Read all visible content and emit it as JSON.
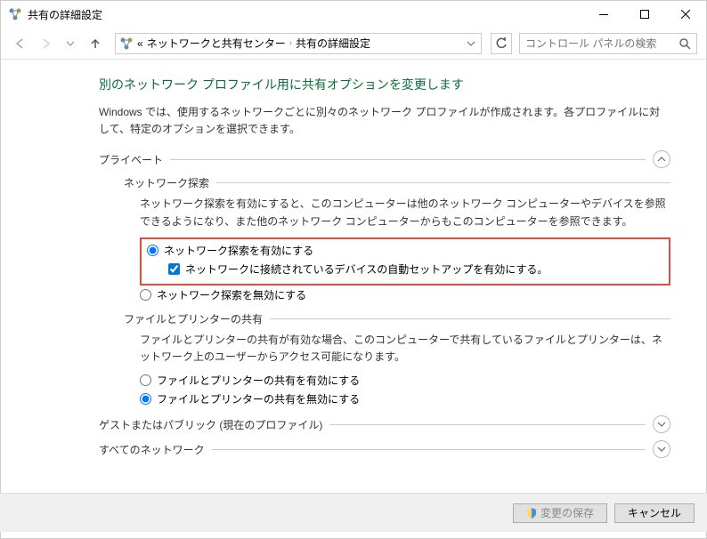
{
  "window": {
    "title": "共有の詳細設定",
    "minimize": "−",
    "maximize": "☐",
    "close": "✕"
  },
  "nav": {
    "breadcrumb_prefix": "«",
    "breadcrumb_item1": "ネットワークと共有センター",
    "breadcrumb_sep": "›",
    "breadcrumb_item2": "共有の詳細設定",
    "search_placeholder": "コントロール パネルの検索"
  },
  "page": {
    "title": "別のネットワーク プロファイル用に共有オプションを変更します",
    "desc": "Windows では、使用するネットワークごとに別々のネットワーク プロファイルが作成されます。各プロファイルに対して、特定のオプションを選択できます。"
  },
  "sections": {
    "private": {
      "label": "プライベート",
      "network_discovery": {
        "label": "ネットワーク探索",
        "desc": "ネットワーク探索を有効にすると、このコンピューターは他のネットワーク コンピューターやデバイスを参照できるようになり、また他のネットワーク コンピューターからもこのコンピューターを参照できます。",
        "radio_enable": "ネットワーク探索を有効にする",
        "checkbox_auto": "ネットワークに接続されているデバイスの自動セットアップを有効にする。",
        "radio_disable": "ネットワーク探索を無効にする"
      },
      "file_printer": {
        "label": "ファイルとプリンターの共有",
        "desc": "ファイルとプリンターの共有が有効な場合、このコンピューターで共有しているファイルとプリンターは、ネットワーク上のユーザーからアクセス可能になります。",
        "radio_enable": "ファイルとプリンターの共有を有効にする",
        "radio_disable": "ファイルとプリンターの共有を無効にする"
      }
    },
    "guest": {
      "label": "ゲストまたはパブリック (現在のプロファイル)"
    },
    "all": {
      "label": "すべてのネットワーク"
    }
  },
  "footer": {
    "save": "変更の保存",
    "cancel": "キャンセル"
  }
}
